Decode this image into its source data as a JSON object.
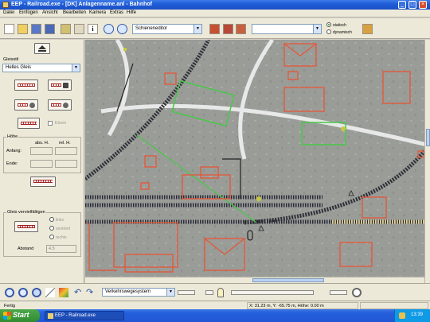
{
  "window": {
    "title": "EEP - Railroad.exe - [DK] Anlagenname.anl - Bahnhof",
    "controls": [
      "_",
      "□",
      "×"
    ]
  },
  "menu": [
    "Datei",
    "Einfügen",
    "Ansicht",
    "Bearbeiten",
    "Kamera",
    "Extras",
    "Hilfe"
  ],
  "toolbar": {
    "editor_select": "Schieneneditor",
    "search_select": "",
    "mode_static": "statisch",
    "mode_dynamic": "dynamisch",
    "icons": [
      "new-file-icon",
      "open-folder-icon",
      "save-icon",
      "save-as-icon",
      "print-icon",
      "settings-icon",
      "info-icon",
      "zoom-in-icon",
      "zoom-out-icon",
      "rail-1-icon",
      "rail-2-icon",
      "rail-3-icon",
      "tools-icon"
    ]
  },
  "panel": {
    "track_style_label": "Gleisstil",
    "track_style_value": "Helles Gleis",
    "drop_label": "Einen",
    "height_group": "Höhe",
    "col_abs": "abs. H.",
    "col_rel": "rel. H.",
    "start_label": "Anfang:",
    "end_label": "Ende:",
    "copy_group": "Gleis vervielfältigen",
    "opt_left": "links",
    "opt_middle": "zentriert",
    "opt_right": "rechts",
    "distance_label": "Abstand",
    "distance_value": "4.5"
  },
  "bottombar": {
    "layer_select": "Verkehrswegesystem"
  },
  "status": {
    "left": "Fertig",
    "coords": "X: 31.23 m, Y: -65.75 m, Höhe: 0.00 m"
  },
  "taskbar": {
    "start_label": "Start",
    "task_label": "EEP - Railroad.exe",
    "clock": "13:39"
  },
  "colors": {
    "titlebar": "#1f5ed8",
    "canvas_ground": "#9e9e9c",
    "overlay_red": "#e05a3c",
    "overlay_green": "#4cc84c",
    "taskbar": "#245edb",
    "start_button": "#318c31"
  }
}
